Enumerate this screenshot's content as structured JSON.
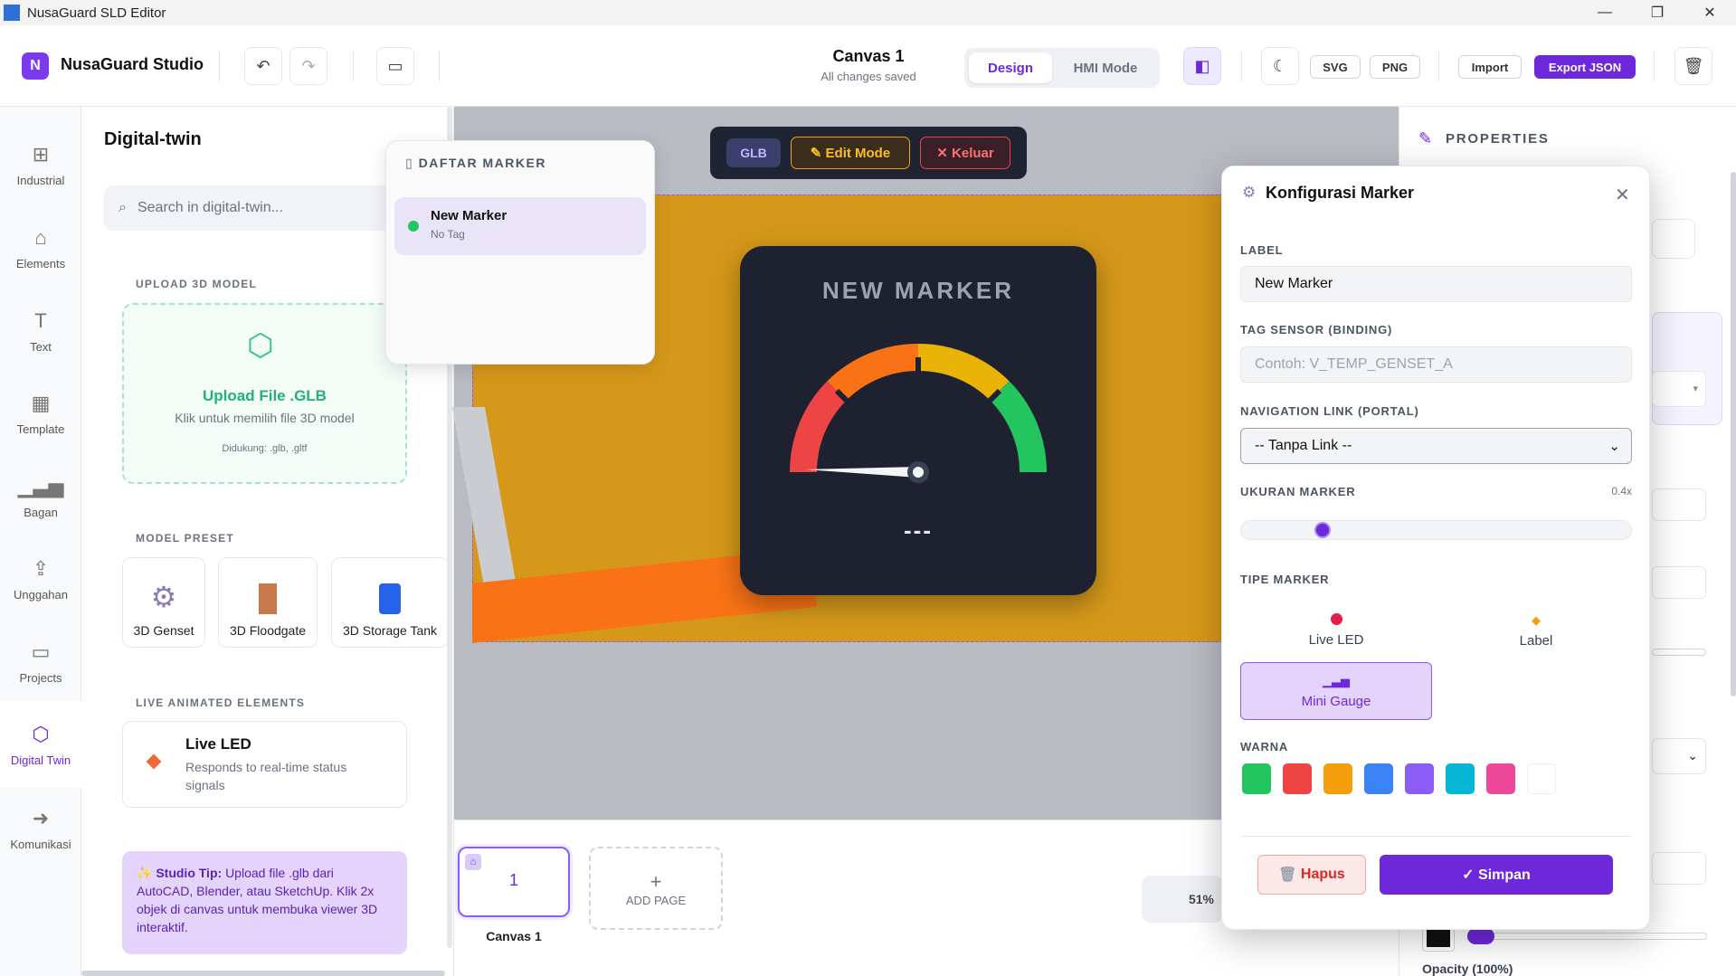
{
  "window": {
    "title": "NusaGuard SLD Editor",
    "min": "—",
    "max": "❐",
    "close": "✕"
  },
  "header": {
    "brand_logo": "N",
    "brand_name": "NusaGuard Studio",
    "canvas_title": "Canvas 1",
    "canvas_status": "All changes saved",
    "mode_design": "Design",
    "mode_hmi": "HMI Mode",
    "svg": "SVG",
    "png": "PNG",
    "import": "Import",
    "export": "Export JSON"
  },
  "sidenav": [
    {
      "label": "Industrial",
      "icon": "industrial-icon"
    },
    {
      "label": "Elements",
      "icon": "elements-icon"
    },
    {
      "label": "Text",
      "icon": "text-icon"
    },
    {
      "label": "Template",
      "icon": "template-icon"
    },
    {
      "label": "Bagan",
      "icon": "chart-icon"
    },
    {
      "label": "Unggahan",
      "icon": "upload-icon"
    },
    {
      "label": "Projects",
      "icon": "folder-icon"
    },
    {
      "label": "Digital Twin",
      "icon": "cube-icon"
    },
    {
      "label": "Komunikasi",
      "icon": "arrow-right-icon"
    }
  ],
  "panel": {
    "title": "Digital-twin",
    "search_placeholder": "Search in digital-twin...",
    "upload_section": "UPLOAD 3D MODEL",
    "upload_title": "Upload File .GLB",
    "upload_desc": "Klik untuk memilih file 3D model",
    "upload_support": "Didukung: .glb, .gltf",
    "preset_section": "MODEL PRESET",
    "presets": [
      "3D Genset",
      "3D Floodgate",
      "3D Storage Tank"
    ],
    "live_section": "LIVE ANIMATED ELEMENTS",
    "live_title": "Live LED",
    "live_desc": "Responds to real-time status signals",
    "tip_label": "Studio Tip:",
    "tip_text": "Upload file .glb dari AutoCAD, Blender, atau SketchUp. Klik 2x objek di canvas untuk membuka viewer 3D interaktif."
  },
  "floatbar": {
    "glb": "GLB",
    "edit": "Edit Mode",
    "exit": "Keluar"
  },
  "marker_list": {
    "title": "DAFTAR MARKER",
    "items": [
      {
        "name": "New Marker",
        "tag": "No Tag"
      }
    ]
  },
  "gauge": {
    "title": "NEW MARKER",
    "value": "---",
    "colors": [
      "#ef4444",
      "#f97316",
      "#eab308",
      "#22c55e"
    ]
  },
  "pages": {
    "page_number": "1",
    "page_name": "Canvas 1",
    "add": "ADD PAGE",
    "zoom": "51%"
  },
  "props": {
    "title": "PROPERTIES",
    "opacity": "Opacity (100%)"
  },
  "modal": {
    "title": "Konfigurasi Marker",
    "label_label": "LABEL",
    "label_value": "New Marker",
    "tag_label": "TAG SENSOR (BINDING)",
    "tag_placeholder": "Contoh: V_TEMP_GENSET_A",
    "nav_label": "NAVIGATION LINK (PORTAL)",
    "nav_value": "-- Tanpa Link --",
    "size_label": "UKURAN MARKER",
    "size_value": "0.4x",
    "size_fraction": 0.2,
    "type_label": "TIPE MARKER",
    "types": [
      "Live LED",
      "Label",
      "Mini Gauge"
    ],
    "selected_type": "Mini Gauge",
    "color_label": "WARNA",
    "colors": [
      "#22c55e",
      "#ef4444",
      "#f59e0b",
      "#3b82f6",
      "#8b5cf6",
      "#06b6d4",
      "#ec4899",
      "#ffffff"
    ],
    "delete": "Hapus",
    "save": "✓ Simpan"
  }
}
